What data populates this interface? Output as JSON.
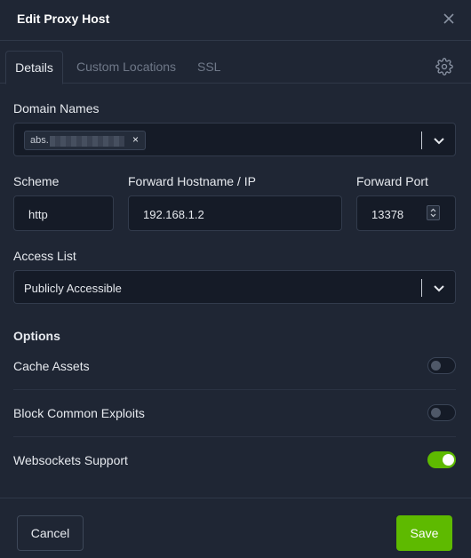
{
  "dialog": {
    "title": "Edit Proxy Host"
  },
  "tabs": [
    {
      "label": "Details",
      "active": true
    },
    {
      "label": "Custom Locations",
      "active": false
    },
    {
      "label": "SSL",
      "active": false
    }
  ],
  "icons": {
    "close": "close-icon",
    "settings": "gear-icon",
    "dropdown": "chevron-down-icon"
  },
  "domain_names": {
    "label": "Domain Names",
    "chips": [
      {
        "text": "abs.",
        "redacted": true
      }
    ]
  },
  "scheme": {
    "label": "Scheme",
    "value": "http"
  },
  "forward_host": {
    "label": "Forward Hostname / IP",
    "value": "192.168.1.2"
  },
  "forward_port": {
    "label": "Forward Port",
    "value": "13378"
  },
  "access_list": {
    "label": "Access List",
    "value": "Publicly Accessible"
  },
  "options": {
    "heading": "Options",
    "items": [
      {
        "label": "Cache Assets",
        "enabled": false
      },
      {
        "label": "Block Common Exploits",
        "enabled": false
      },
      {
        "label": "Websockets Support",
        "enabled": true
      }
    ]
  },
  "footer": {
    "cancel_label": "Cancel",
    "save_label": "Save"
  },
  "colors": {
    "accent": "#5eba00",
    "background": "#1f2634",
    "input_bg": "#151b27"
  }
}
